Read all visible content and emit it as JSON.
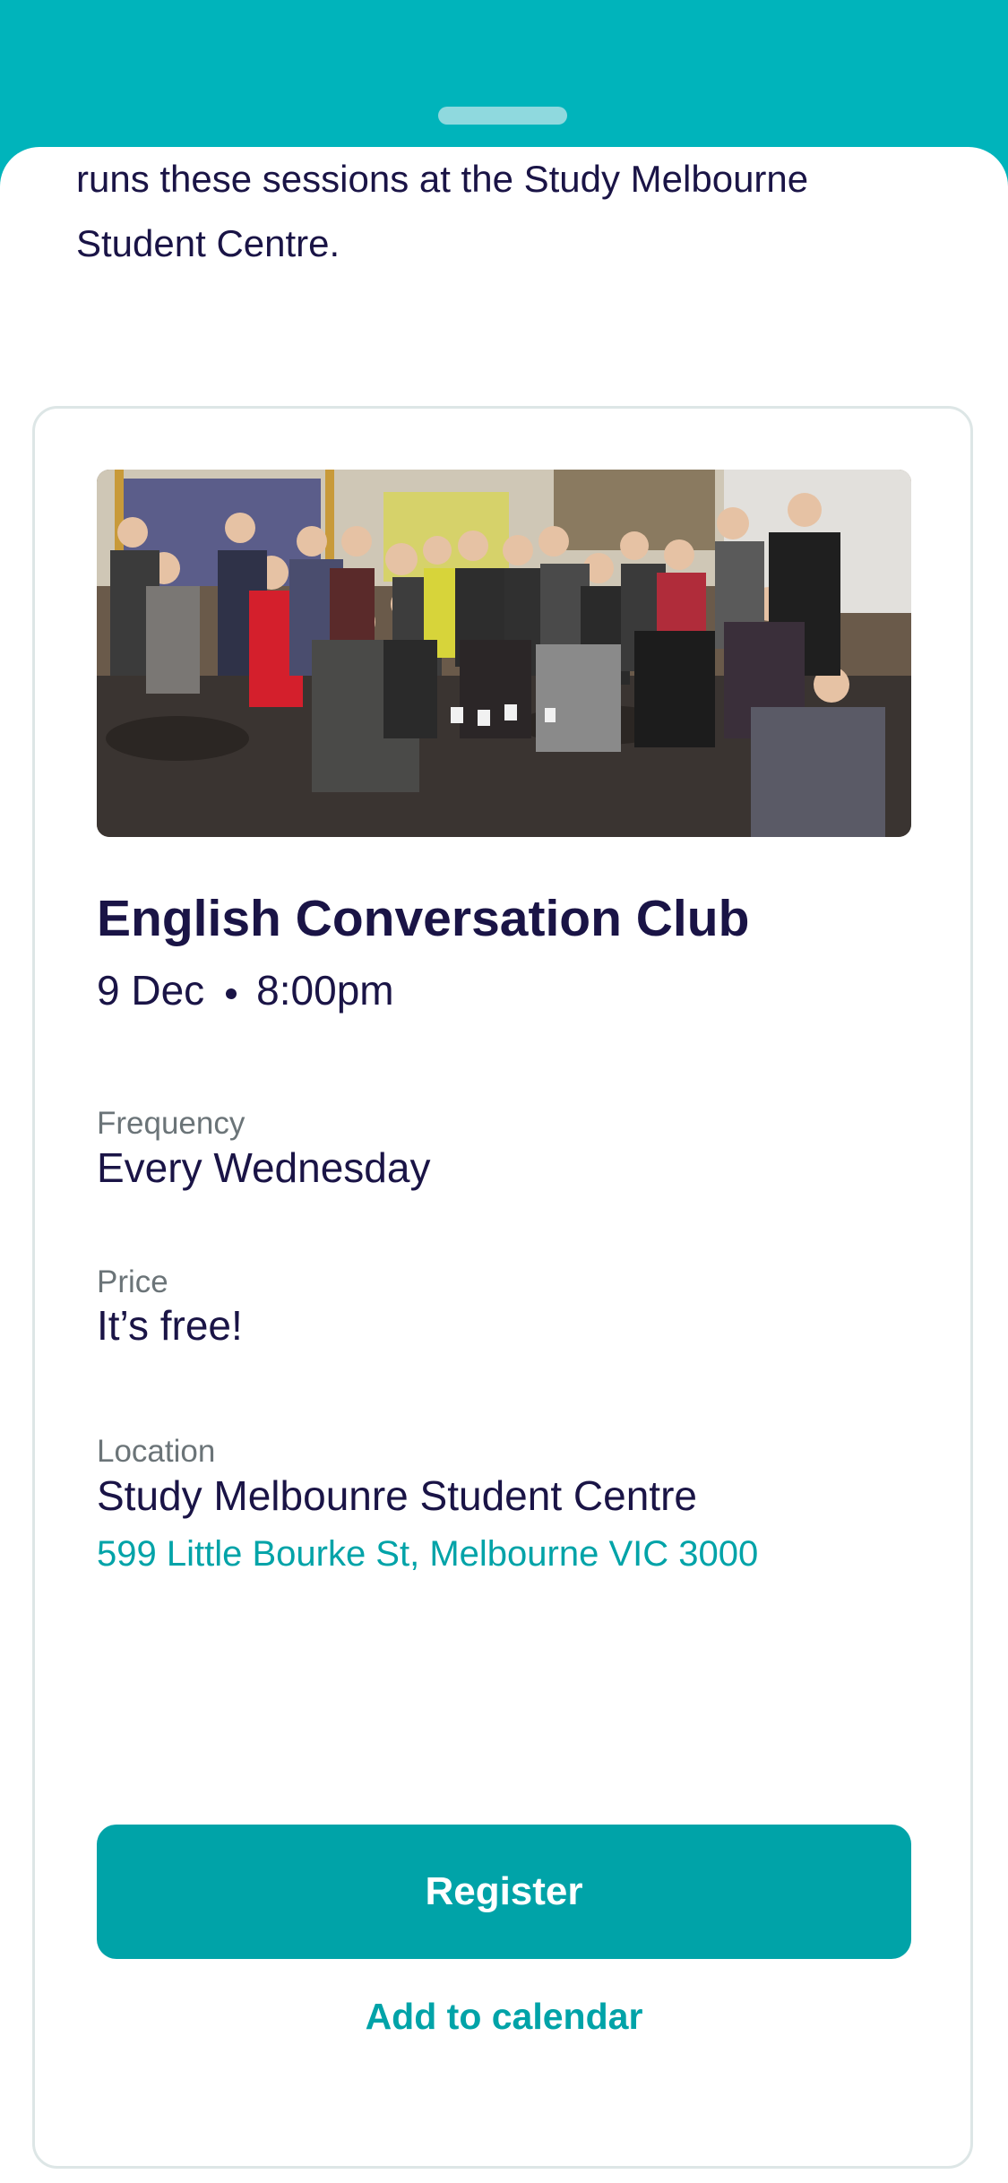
{
  "intro": {
    "line1": "runs these sessions at the Study Melbourne",
    "line2": "Student Centre."
  },
  "event": {
    "photo_alt": "group-photo",
    "title": "English Conversation Club",
    "date": "9 Dec",
    "time": "8:00pm",
    "frequency_label": "Frequency",
    "frequency_value": "Every Wednesday",
    "price_label": "Price",
    "price_value": "It’s free!",
    "location_label": "Location",
    "location_name": "Study Melbounre Student Centre",
    "location_address": "599 Little Bourke St, Melbourne VIC 3000"
  },
  "actions": {
    "register": "Register",
    "add_to_calendar": "Add to calendar"
  },
  "colors": {
    "accent": "#00a3a8",
    "header": "#00b4bb",
    "text": "#1a1446",
    "muted": "#6b7478"
  }
}
